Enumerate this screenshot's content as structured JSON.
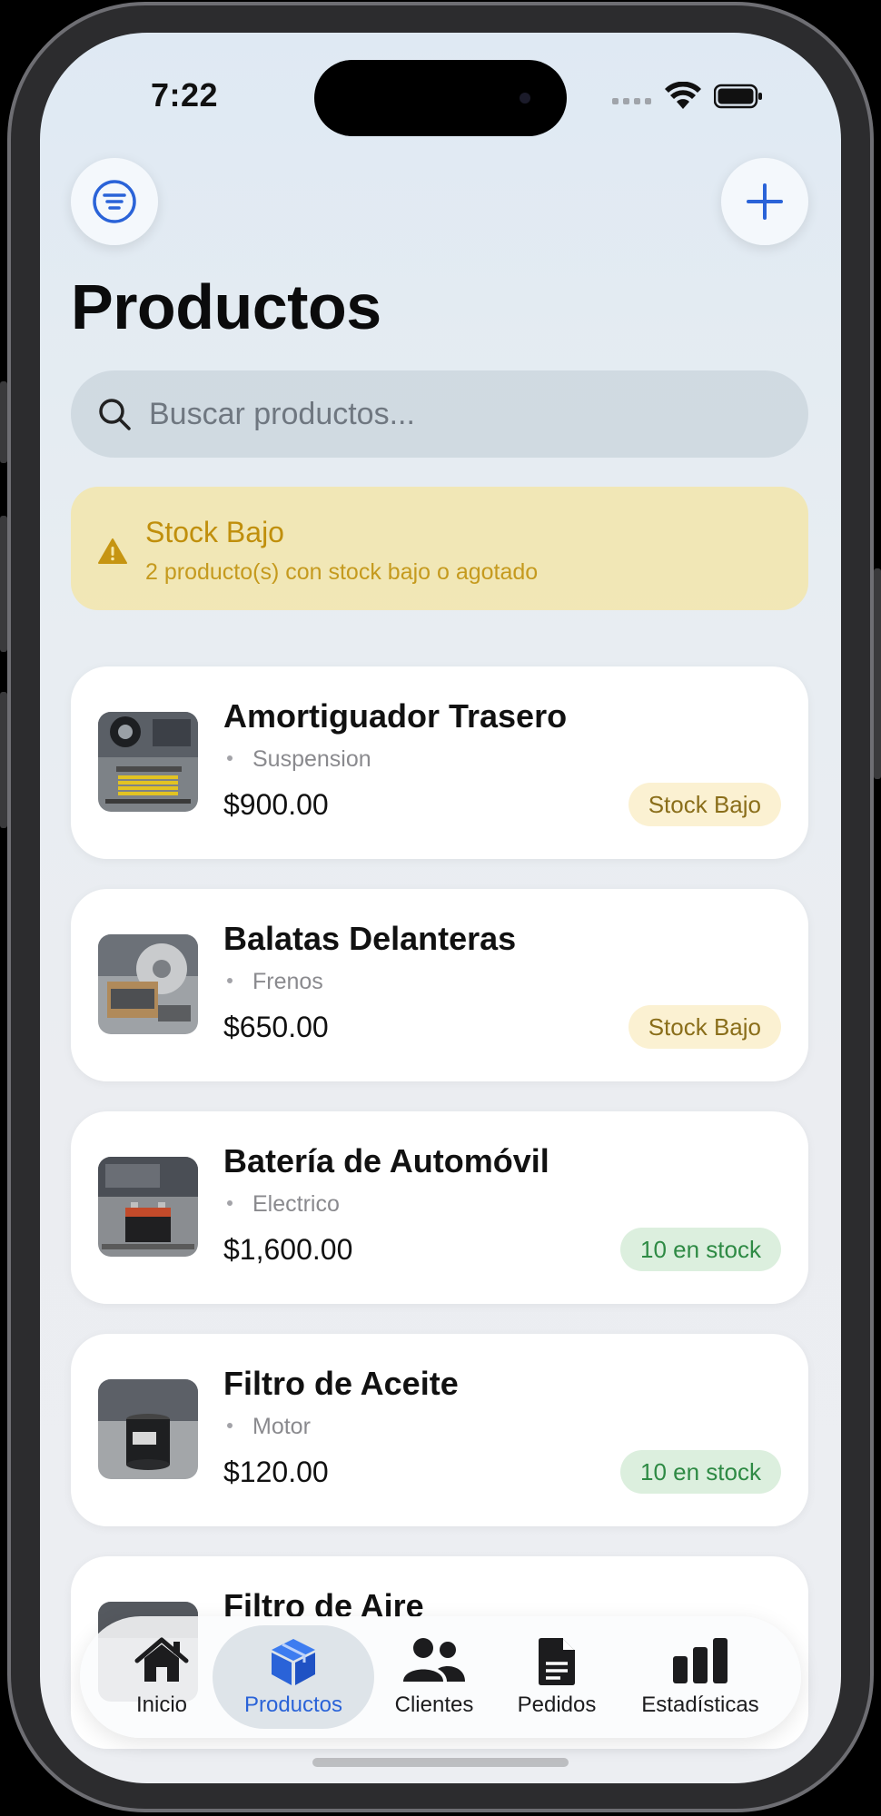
{
  "status": {
    "time": "7:22"
  },
  "header": {
    "title": "Productos"
  },
  "search": {
    "placeholder": "Buscar productos..."
  },
  "alert": {
    "title": "Stock Bajo",
    "message": "2 producto(s) con stock bajo o agotado"
  },
  "products": [
    {
      "name": "Amortiguador Trasero",
      "category": "Suspension",
      "price": "$900.00",
      "stock": "Stock Bajo",
      "stock_status": "low"
    },
    {
      "name": "Balatas Delanteras",
      "category": "Frenos",
      "price": "$650.00",
      "stock": "Stock Bajo",
      "stock_status": "low"
    },
    {
      "name": "Batería de Automóvil",
      "category": "Electrico",
      "price": "$1,600.00",
      "stock": "10 en stock",
      "stock_status": "ok"
    },
    {
      "name": "Filtro de Aceite",
      "category": "Motor",
      "price": "$120.00",
      "stock": "10 en stock",
      "stock_status": "ok"
    },
    {
      "name": "Filtro de Aire",
      "category": "",
      "price": "",
      "stock": "",
      "stock_status": "ok"
    }
  ],
  "tabs": [
    {
      "label": "Inicio",
      "icon": "house-icon",
      "active": false
    },
    {
      "label": "Productos",
      "icon": "box-icon",
      "active": true
    },
    {
      "label": "Clientes",
      "icon": "people-icon",
      "active": false
    },
    {
      "label": "Pedidos",
      "icon": "document-icon",
      "active": false
    },
    {
      "label": "Estadísticas",
      "icon": "bar-chart-icon",
      "active": false
    }
  ],
  "colors": {
    "accent": "#2a63d8",
    "warning": "#c08f0c",
    "ok": "#2e8a44"
  }
}
